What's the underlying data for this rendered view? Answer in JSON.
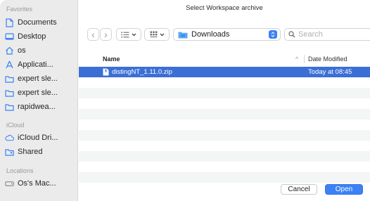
{
  "dialog": {
    "title": "Select Workspace archive"
  },
  "sidebar": {
    "favorites_label": "Favorites",
    "favorites": [
      {
        "label": "Documents",
        "icon": "document-icon"
      },
      {
        "label": "Desktop",
        "icon": "desktop-icon"
      },
      {
        "label": "os",
        "icon": "home-icon"
      },
      {
        "label": "Applicati...",
        "icon": "applications-icon"
      },
      {
        "label": "expert sle...",
        "icon": "folder-icon"
      },
      {
        "label": "expert sle...",
        "icon": "folder-icon"
      },
      {
        "label": "rapidwea...",
        "icon": "folder-icon"
      }
    ],
    "icloud_label": "iCloud",
    "icloud": [
      {
        "label": "iCloud Dri...",
        "icon": "cloud-icon"
      },
      {
        "label": "Shared",
        "icon": "shared-folder-icon"
      }
    ],
    "locations_label": "Locations",
    "locations": [
      {
        "label": "Os's Mac...",
        "icon": "drive-icon"
      }
    ]
  },
  "toolbar": {
    "back_glyph": "‹",
    "forward_glyph": "›",
    "location": "Downloads",
    "search_placeholder": "Search"
  },
  "list": {
    "col_name": "Name",
    "col_date": "Date Modified",
    "sort_glyph": "^",
    "files": [
      {
        "name": "distingNT_1.11.0.zip",
        "date": "Today at 08:45",
        "selected": true
      }
    ]
  },
  "buttons": {
    "cancel": "Cancel",
    "open": "Open"
  },
  "colors": {
    "accent": "#3b82f6",
    "selection": "#3b6fd6",
    "sidebar": "#ebebeb"
  }
}
